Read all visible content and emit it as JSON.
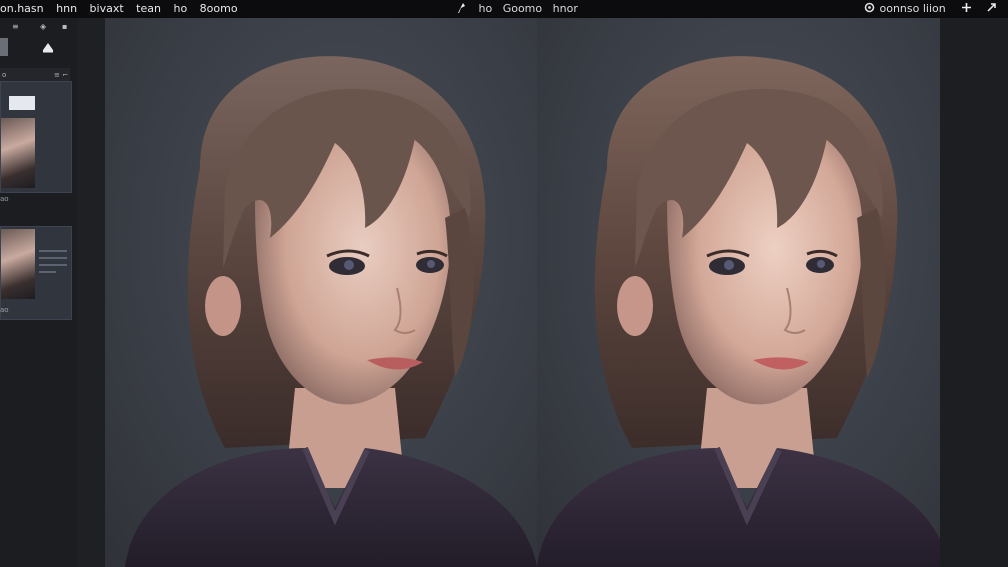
{
  "menu": {
    "items": [
      "on.hasn",
      "hnn",
      "bivaxt",
      "tean",
      "ho",
      "8oomo"
    ]
  },
  "title": {
    "items": [
      "ho",
      "Goomo",
      "hnor"
    ]
  },
  "tools": {
    "label": "oonnso liion"
  },
  "left_panel": {
    "row_icons": [
      "≡",
      "◈",
      "▪"
    ],
    "header_left": "o",
    "header_right": "≡  ⌐",
    "small_a": "ao",
    "small_b": "ao"
  },
  "icons": {
    "logo": "feather-icon",
    "settings": "gear-icon",
    "add": "plus-icon",
    "share": "share-icon"
  },
  "colors": {
    "topbar": "#0c0c0e",
    "sidebar": "#1c1d21",
    "canvas": "#3b3f47",
    "hair": "#5e4a43",
    "sweater": "#2d2634"
  }
}
